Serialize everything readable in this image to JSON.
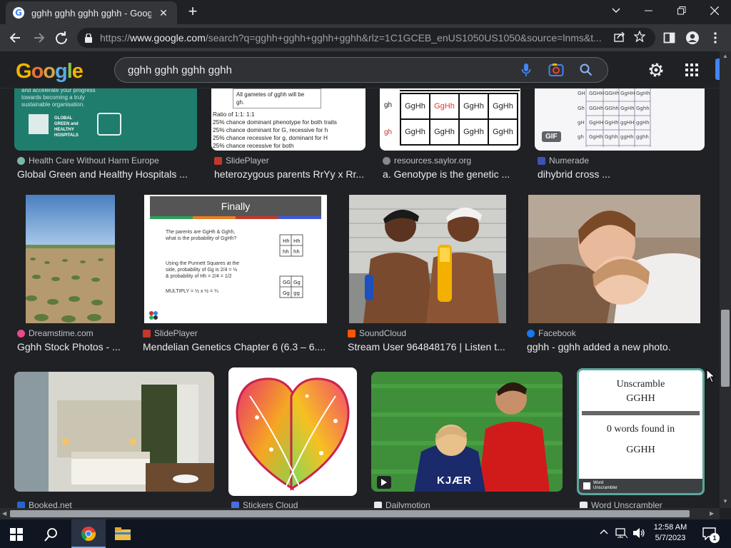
{
  "browser": {
    "tab_title": "gghh gghh gghh gghh - Google",
    "tab_close": "✕",
    "new_tab": "+",
    "url_prefix": "https://",
    "url_domain": "www.google.com",
    "url_rest": "/search?q=gghh+gghh+gghh+gghh&rlz=1C1GCEB_enUS1050US1050&source=lnms&t..."
  },
  "google": {
    "logo_letters": [
      "G",
      "o",
      "o",
      "g",
      "l",
      "e"
    ],
    "query": "gghh gghh gghh gghh"
  },
  "results": {
    "row1": [
      {
        "source": "Health Care Without Harm Europe",
        "title": "Global Green and Healthy Hospitals ...",
        "thumb_lines": [
          "and accelerate your progress",
          "towards becoming a truly",
          "sustainable organisation."
        ],
        "thumb_badge": "GLOBAL GREEN and HEALTHY HOSPITALS"
      },
      {
        "source": "SlidePlayer",
        "title": "heterozygous parents RrYy x Rr...",
        "thumb_lines": [
          "All gametes of gghh will be",
          "gh.",
          "Ratio of 1:1: 1:1",
          "25% chance dominant phenotype for both traits",
          "25% chance dominant for G, recessive for h",
          "25% chance recessive for g, dominant for H",
          "25% chance recessive for both"
        ]
      },
      {
        "source": "resources.saylor.org",
        "title": "a. Genotype is the genetic ...",
        "row_labels": [
          "gh",
          "gh"
        ],
        "cells": [
          [
            "GgHh",
            "GgHh",
            "GgHh",
            "GgHh"
          ],
          [
            "GgHh",
            "GgHh",
            "GgHh",
            "GgHh"
          ]
        ]
      },
      {
        "source": "Numerade",
        "title": "dihybrid cross ...",
        "badge": "GIF"
      }
    ],
    "row2": [
      {
        "source": "Dreamstime.com",
        "title": "Gghh Stock Photos - ..."
      },
      {
        "source": "SlidePlayer",
        "title": "Mendelian Genetics Chapter 6 (6.3 – 6....",
        "slide_heading": "Finally",
        "slide_lines": [
          "The parents are GgHh & Gghh,",
          "what is the probability of GgHh?",
          "Using the Punnett Squares at the",
          "side, probability of Gg is 2/4 = ½",
          "& probability of Hh = 2/4 = 1/2",
          "MULTIPLY = ½ x ½ = ¼"
        ]
      },
      {
        "source": "SoundCloud",
        "title": "Stream User 964848176 | Listen t..."
      },
      {
        "source": "Facebook",
        "title": "gghh - gghh added a new photo."
      }
    ],
    "row3": [
      {
        "source": "Booked.net"
      },
      {
        "source": "Stickers Cloud"
      },
      {
        "source": "Dailymotion",
        "jersey": "KJÆR"
      },
      {
        "source": "Word Unscrambler",
        "card_lines": [
          "Unscramble",
          "GGHH",
          "0 words found in",
          "GGHH"
        ],
        "card_footer": "Word Unscrambler"
      }
    ]
  },
  "taskbar": {
    "time": "12:58 AM",
    "date": "5/7/2023",
    "notification_count": "1"
  },
  "colors": {
    "background": "#202124",
    "chrome": "#35363a",
    "taskbar": "#0f1621"
  }
}
